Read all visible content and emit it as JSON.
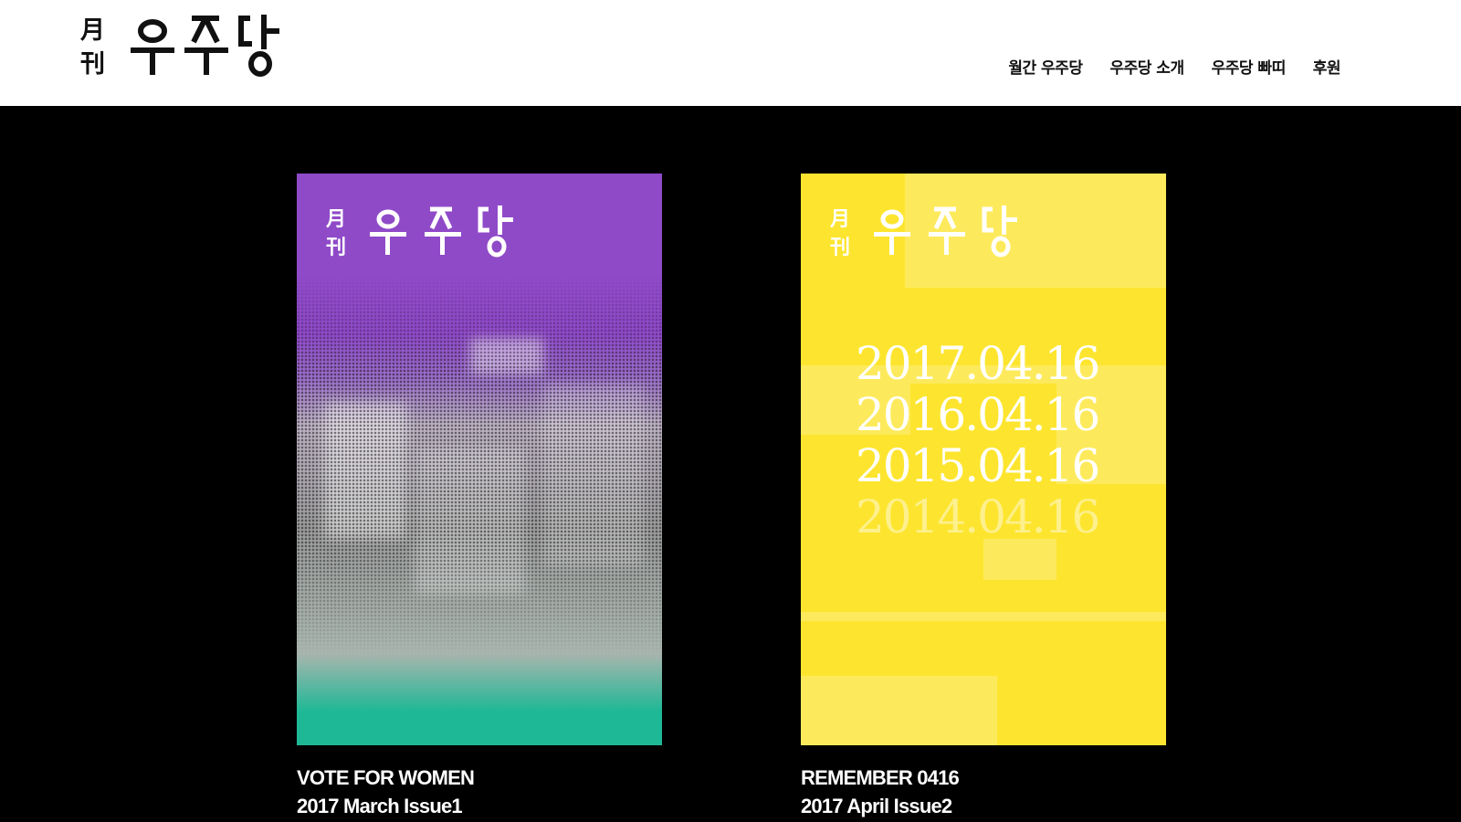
{
  "brand": {
    "logo_glyphs": [
      "月",
      "刊",
      "우",
      "주",
      "당"
    ],
    "logo_text_hidden": "月刊 우주당"
  },
  "nav": {
    "items": [
      "월간 우주당",
      "우주당 소개",
      "우주당 빠띠",
      "후원"
    ]
  },
  "issues": [
    {
      "title": "VOTE FOR WOMEN",
      "subtitle": "2017 March Issue1",
      "cover_colors": {
        "top": "#8f4ac8",
        "bottom": "#1fb896"
      }
    },
    {
      "title": "REMEMBER 0416",
      "subtitle": "2017 April Issue2",
      "cover_colors": {
        "background": "#fde52f"
      },
      "dates": [
        "2017.04.16",
        "2016.04.16",
        "2015.04.16",
        "2014.04.16"
      ]
    }
  ],
  "colors": {
    "header_bg": "#ffffff",
    "page_bg": "#000000",
    "text_light": "#ffffff",
    "text_dark": "#111111"
  }
}
